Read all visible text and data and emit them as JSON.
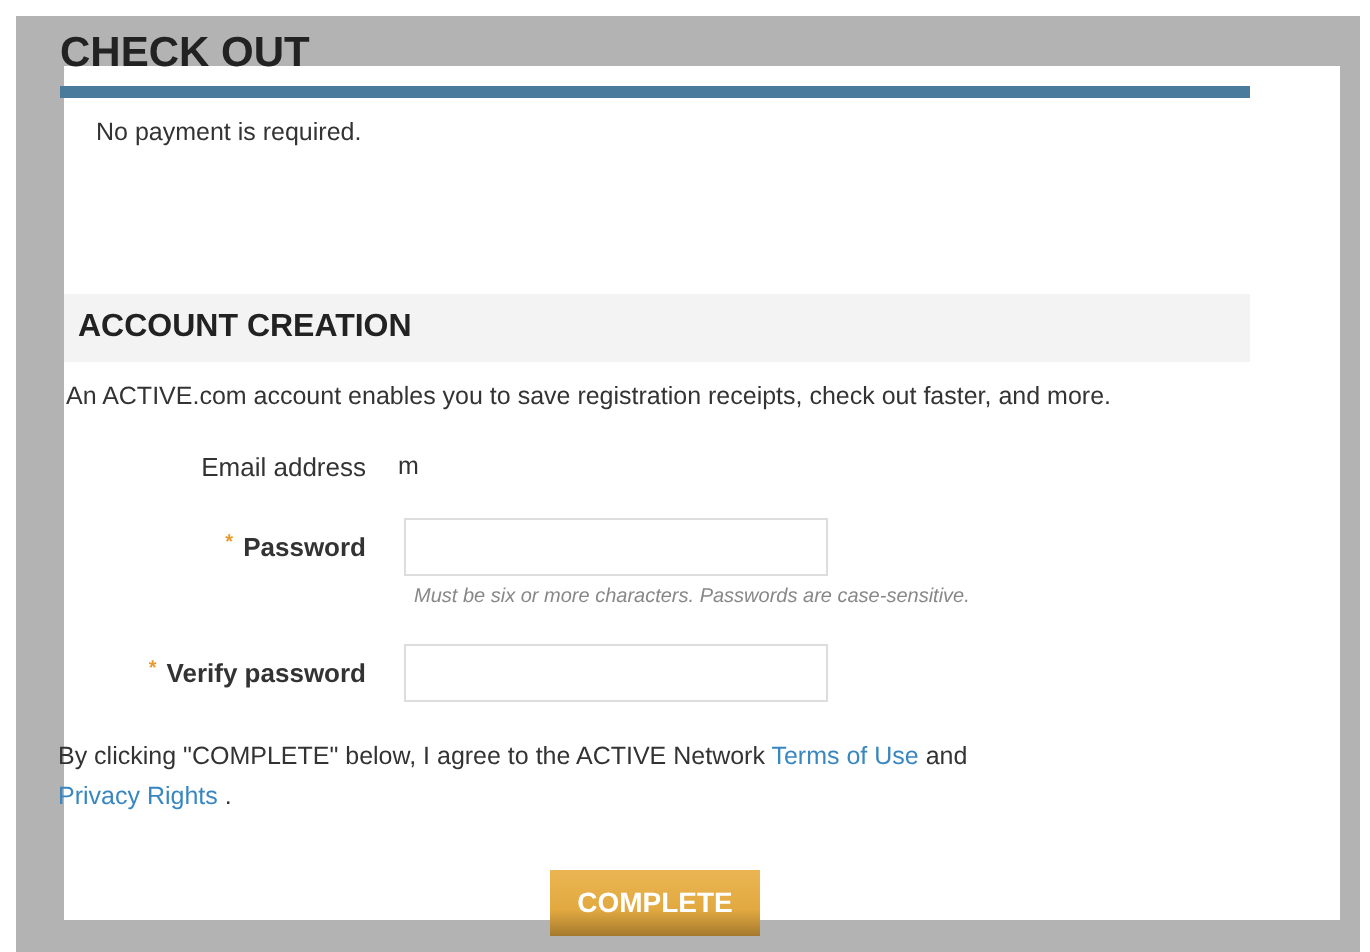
{
  "title": "CHECK OUT",
  "payment_note": "No payment is required.",
  "account_section": {
    "heading": "ACCOUNT CREATION",
    "intro": "An ACTIVE.com account enables you to save registration receipts, check out faster, and more.",
    "fields": [
      {
        "kind": "static",
        "label": "Email address",
        "value": "m"
      },
      {
        "kind": "password",
        "label": "Password",
        "required": true,
        "required_mark": "*",
        "hint": "Must be six or more characters. Passwords are case-sensitive."
      },
      {
        "kind": "password",
        "label": "Verify password",
        "required": true,
        "required_mark": "*"
      }
    ]
  },
  "agreement": [
    {
      "kind": "text",
      "text": "By clicking \"COMPLETE\" below, I agree to the ACTIVE Network "
    },
    {
      "kind": "link",
      "text": "Terms of Use"
    },
    {
      "kind": "text",
      "text": " and "
    },
    {
      "kind": "link",
      "text": "Privacy Rights"
    },
    {
      "kind": "text",
      "text": " ."
    }
  ],
  "submit_button": "COMPLETE"
}
